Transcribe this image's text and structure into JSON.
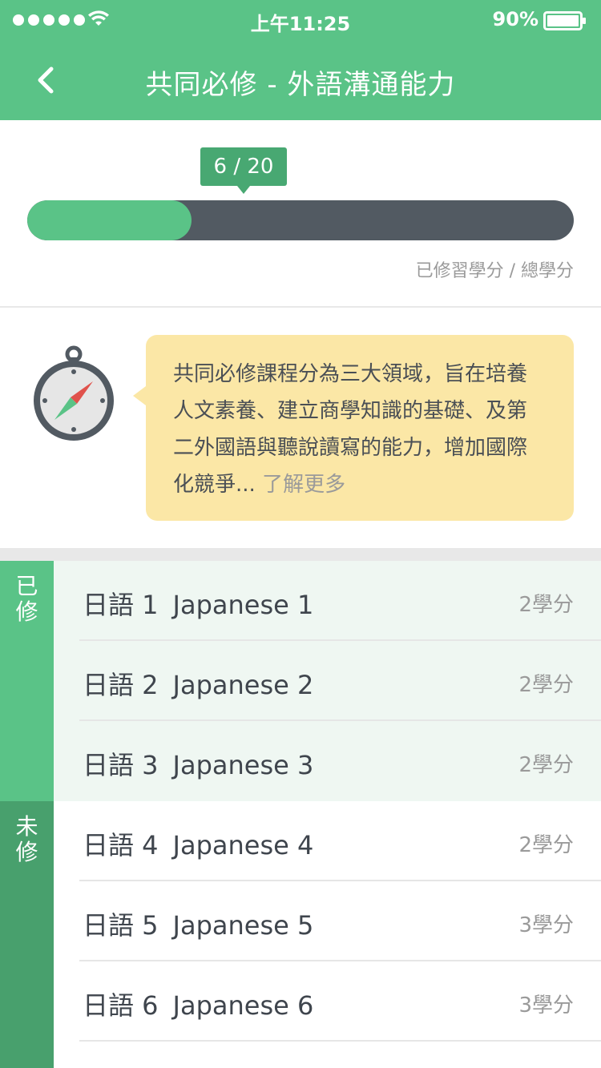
{
  "status_bar": {
    "time": "上午11:25",
    "battery": "90%"
  },
  "nav": {
    "title": "共同必修 - 外語溝通能力"
  },
  "progress": {
    "label": "6 / 20",
    "completed": 6,
    "total": 20,
    "caption": "已修習學分 / 總學分"
  },
  "info": {
    "text": "共同必修課程分為三大領域，旨在培養人文素養、建立商學知識的基礎、及第二外國語與聽說讀寫的能力，增加國際化競爭...",
    "more_link": "了解更多"
  },
  "sections": {
    "completed_label": "已修",
    "pending_label": "未修"
  },
  "courses": [
    {
      "name": "日語 1",
      "en": "Japanese 1",
      "credits": "2學分"
    },
    {
      "name": "日語 2",
      "en": "Japanese 2",
      "credits": "2學分"
    },
    {
      "name": "日語 3",
      "en": "Japanese 3",
      "credits": "2學分"
    },
    {
      "name": "日語 4",
      "en": "Japanese 4",
      "credits": "2學分"
    },
    {
      "name": "日語 5",
      "en": "Japanese 5",
      "credits": "3學分"
    },
    {
      "name": "日語 6",
      "en": "Japanese 6",
      "credits": "3學分"
    }
  ],
  "colors": {
    "primary_green": "#5ac387",
    "dark_green": "#48a06d",
    "track_gray": "#525a62",
    "bubble_yellow": "#fbe7a6"
  },
  "icons": [
    "signal-dots-icon",
    "wifi-icon",
    "battery-icon",
    "back-chevron-icon",
    "compass-icon"
  ]
}
